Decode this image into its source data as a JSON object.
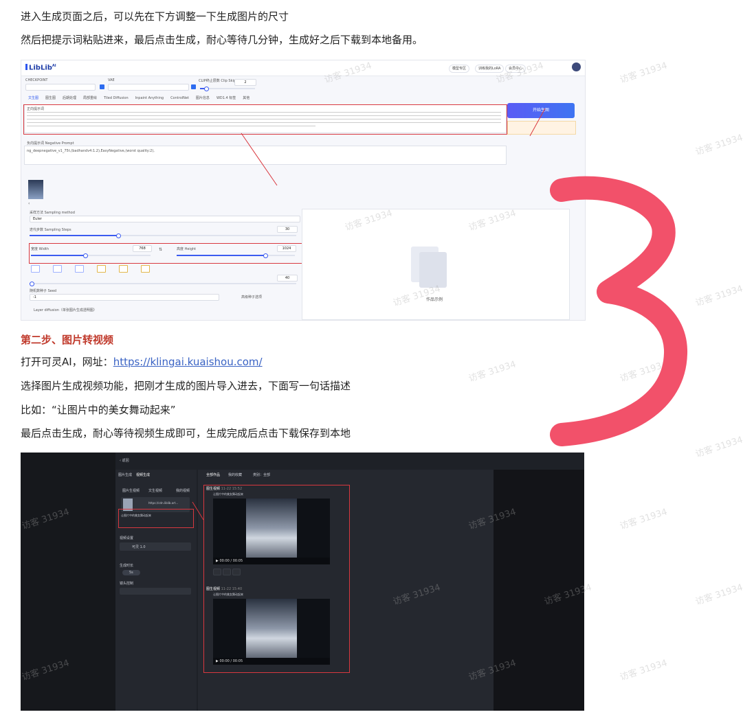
{
  "article": {
    "line1": "进入生成页面之后，可以先在下方调整一下生成图片的尺寸",
    "line2": "然后把提示词粘贴进来，最后点击生成，耐心等待几分钟，生成好之后下载到本地备用。",
    "step2_heading": "第二步、图片转视频",
    "open_prefix": "打开可灵AI，网址：",
    "kling_url": "https://klingai.kuaishou.com/",
    "line_select": "选择图片生成视频功能，把刚才生成的图片导入进去，下面写一句话描述",
    "line_example": "比如：“让图片中的美女舞动起来”",
    "line_final": "最后点击生成，耐心等待视频生成即可，生成完成后点击下载保存到本地"
  },
  "watermark": "访客 31934",
  "colors": {
    "heading": "#c0392b",
    "link": "#3a63c4",
    "annotation": "#d9383f",
    "scribble": "#f2516a"
  },
  "liblib": {
    "logo": "LibLib",
    "logo_sup": "AI",
    "top_buttons": [
      "模型专区",
      "训练我的LoRA",
      "会员中心"
    ],
    "checkpoint_label": "CHECKPOINT",
    "vae_label": "VAE",
    "clip_label": "CLIP终止层数 Clip Skip",
    "clip_value": "2",
    "tabs": [
      "文生图",
      "图生图",
      "后期处理",
      "局部重绘",
      "Tiled Diffusion",
      "Inpaint Anything",
      "ControlNet",
      "图片信息",
      "WD1.4 标签",
      "其他"
    ],
    "prompt_label": "正向提示词",
    "negative_label": "负向提示词 Negative Prompt",
    "negative_text": "ng_deepnegative_v1_75t,(badhandv4:1.2),EasyNegative,(worst quality:2),",
    "generate_label": "开始生图",
    "sampler_value": "Euler",
    "steps_label": "迭代步数 Sampling Steps",
    "steps_value": "30",
    "width_label": "宽度 Width",
    "width_value": "768",
    "height_label": "高度 Height",
    "height_value": "1024",
    "batch_count": "40",
    "seed_label": "随机数种子 Seed",
    "seed_value": "-1",
    "layer_label": "Layer diffusion（单张图片生成透明图）",
    "preview_label": "作品示例"
  },
  "kling": {
    "back": "返回",
    "panel_tabs": [
      "图片生成",
      "视频生成"
    ],
    "mode_tabs": [
      "图片生视频",
      "文生视频",
      "我的视频"
    ],
    "upload_name": "https://cdn.liblib.art...",
    "prompt_text": "让图片中的美女舞动起来",
    "settings_label": "视频设置",
    "model_label": "可灵 1.0",
    "duration_label": "生成时长",
    "duration_value": "5s",
    "camera_label": "镜头控制",
    "main_tabs": [
      "全部作品",
      "我的收藏",
      "类别：全部"
    ],
    "items": [
      {
        "title": "图生视频",
        "time": "11-22 15:52",
        "desc": "让图片中的美女舞动起来",
        "time_code": "00:00 / 00:05"
      },
      {
        "title": "图生视频",
        "time": "11-22 15:40",
        "desc": "让图片中的美女舞动起来",
        "time_code": "00:00 / 00:05"
      }
    ]
  }
}
